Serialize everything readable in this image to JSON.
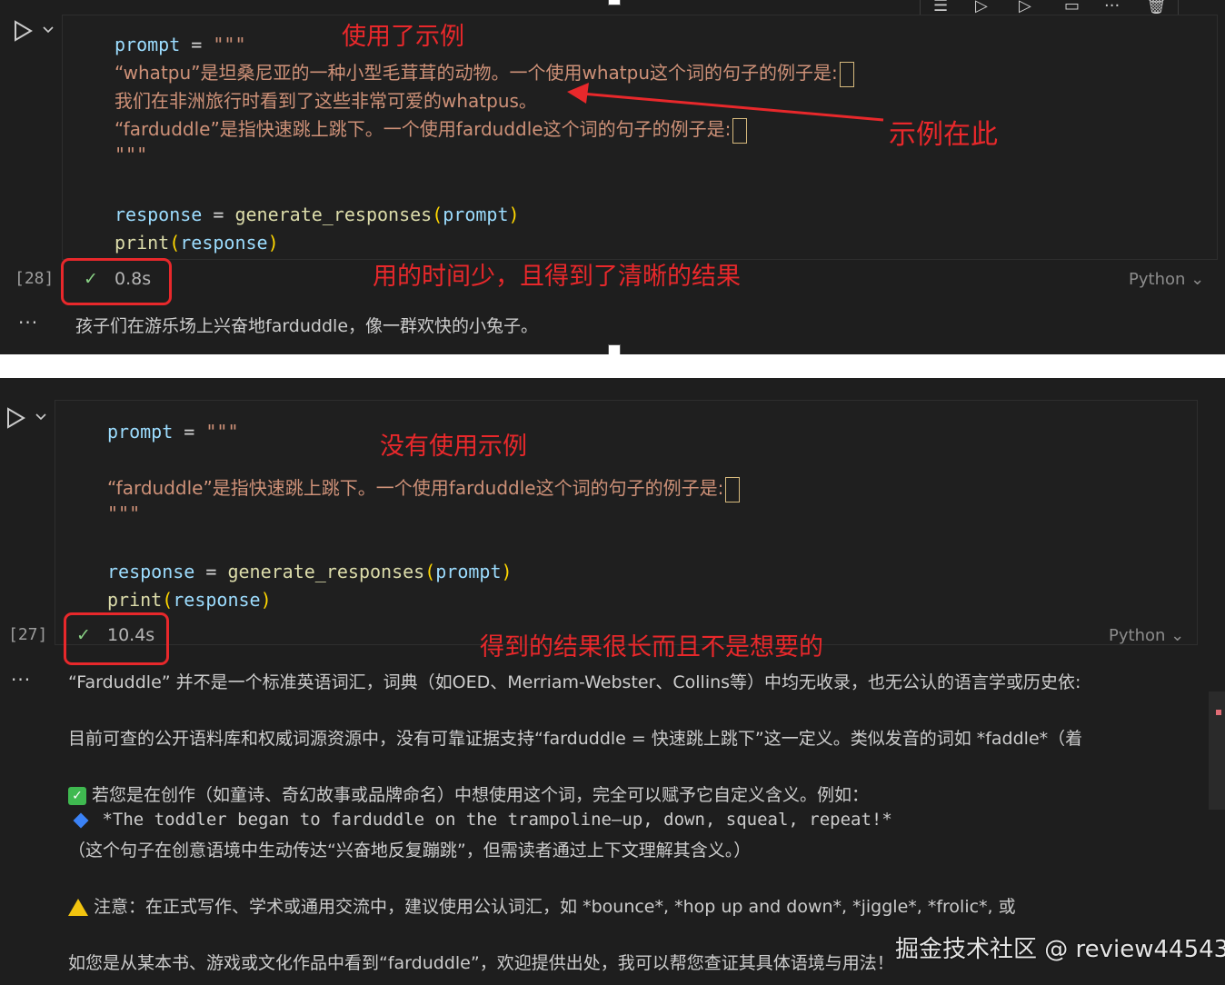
{
  "cell1": {
    "exec_count": "[28]",
    "code": {
      "prompt_var": "prompt",
      "equals": "=",
      "triple_quote": "\"\"\"",
      "line2": "“whatpu”是坦桑尼亚的一种小型毛茸茸的动物。一个使用whatpu这个词的句子的例子是:",
      "line3": "我们在非洲旅行时看到了这些非常可爱的whatpus。",
      "line4": "“farduddle”是指快速跳上跳下。一个使用farduddle这个词的句子的例子是:",
      "response_var": "response",
      "fn_name": "generate_responses",
      "fn_arg": "prompt",
      "print_fn": "print",
      "print_arg": "response",
      "open_paren": "(",
      "close_paren": ")"
    },
    "status_time": "0.8s",
    "language": "Python",
    "output": "孩子们在游乐场上兴奋地farduddle，像一群欢快的小兔子。",
    "annotations": {
      "used_example": "使用了示例",
      "example_here": "示例在此",
      "result_note": "用的时间少，且得到了清晰的结果"
    }
  },
  "cell2": {
    "exec_count": "[27]",
    "code": {
      "prompt_var": "prompt",
      "equals": "=",
      "triple_quote": "\"\"\"",
      "line3": "“farduddle”是指快速跳上跳下。一个使用farduddle这个词的句子的例子是:",
      "response_var": "response",
      "fn_name": "generate_responses",
      "fn_arg": "prompt",
      "print_fn": "print",
      "print_arg": "response",
      "open_paren": "(",
      "close_paren": ")"
    },
    "status_time": "10.4s",
    "language": "Python",
    "output_lines": [
      "“Farduddle” 并不是一个标准英语词汇，词典（如OED、Merriam-Webster、Collins等）中均无收录，也无公认的语言学或历史依:",
      "目前可查的公开语料库和权威词源资源中，没有可靠证据支持“farduddle = 快速跳上跳下”这一定义。类似发音的词如 *faddle*（着",
      "若您是在创作（如童诗、奇幻故事或品牌命名）中想使用这个词，完全可以赋予它自定义含义。例如：",
      "*The toddler began to farduddle on the trampoline—up, down, squeal, repeat!*",
      "（这个句子在创意语境中生动传达“兴奋地反复蹦跳”，但需读者通过上下文理解其含义。）",
      "注意：在正式写作、学术或通用交流中，建议使用公认词汇，如 *bounce*, *hop up and down*, *jiggle*, *frolic*, 或",
      "如您是从某本书、游戏或文化作品中看到“farduddle”，欢迎提供出处，我可以帮您查证其具体语境与用法！"
    ],
    "annotations": {
      "no_example": "没有使用示例",
      "result_note": "得到的结果很长而且不是想要的"
    }
  },
  "watermark": "掘金技术社区 @ review44543",
  "ellipsis": "···",
  "toolbar_more": "···",
  "check_mark": "✓",
  "icons": [
    "run-cell-icon",
    "chevron-down-icon",
    "check-icon",
    "trash-icon",
    "split-cell-icon"
  ],
  "colors": {
    "annotation_red": "#e8282b",
    "keyword_blue": "#9cdcfe",
    "string_orange": "#ce9178",
    "function_yellow": "#dcdcaa"
  }
}
